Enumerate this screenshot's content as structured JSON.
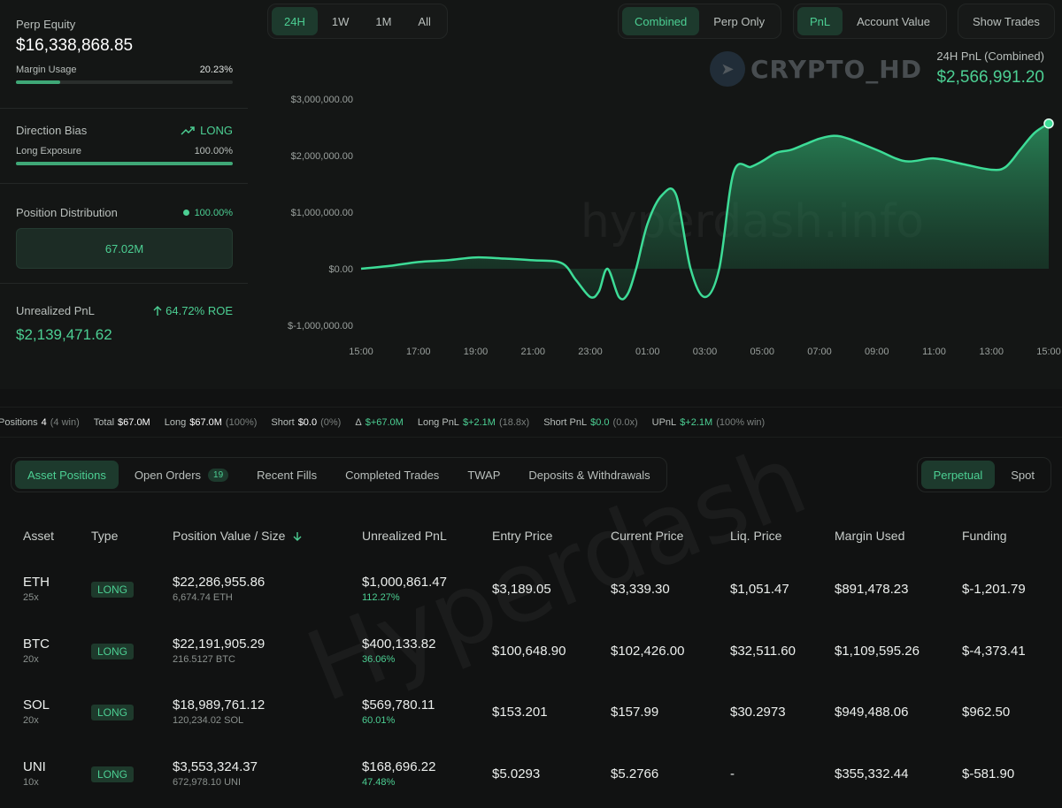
{
  "left": {
    "equity_label": "Perp Equity",
    "equity_value": "$16,338,868.85",
    "margin_label": "Margin Usage",
    "margin_value": "20.23%",
    "margin_fraction": 0.2023,
    "bias_label": "Direction Bias",
    "bias_value": "LONG",
    "long_exposure_label": "Long Exposure",
    "long_exposure_value": "100.00%",
    "long_exposure_fraction": 1.0,
    "distribution_label": "Position Distribution",
    "distribution_value": "100.00%",
    "distribution_box": "67.02M",
    "upnl_label": "Unrealized PnL",
    "upnl_roe": "64.72% ROE",
    "upnl_value": "$2,139,471.62"
  },
  "timeframes": [
    "24H",
    "1W",
    "1M",
    "All"
  ],
  "active_timeframe": "24H",
  "mode_tabs": [
    "Combined",
    "Perp Only"
  ],
  "active_mode": "Combined",
  "metric_tabs": [
    "PnL",
    "Account Value"
  ],
  "active_metric": "PnL",
  "show_trades_label": "Show Trades",
  "pnl_header": {
    "label": "24H PnL (Combined)",
    "value": "$2,566,991.20"
  },
  "watermarks": {
    "brand": "CRYPTO_HD",
    "site": "hyperdash.info",
    "table": "Hyperdash"
  },
  "chart_data": {
    "type": "area",
    "y_tick_labels": [
      "$3,000,000.00",
      "$2,000,000.00",
      "$1,000,000.00",
      "$0.00",
      "$-1,000,000.00"
    ],
    "x_tick_labels": [
      "15:00",
      "17:00",
      "19:00",
      "21:00",
      "23:00",
      "01:00",
      "03:00",
      "05:00",
      "07:00",
      "09:00",
      "11:00",
      "13:00",
      "15:00"
    ],
    "ylim": [
      -1000000,
      3000000
    ],
    "grid": false,
    "x_hours": [
      0,
      1,
      2,
      3,
      4,
      5,
      6,
      7,
      7.5,
      8,
      8.3,
      8.6,
      9,
      9.3,
      9.6,
      10,
      10.5,
      11,
      11.5,
      12,
      12.5,
      13,
      13.6,
      14,
      14.5,
      15,
      15.5,
      16,
      16.5,
      17,
      18,
      19,
      20,
      21,
      22,
      22.5,
      23,
      23.5,
      24
    ],
    "values": [
      0,
      50000,
      120000,
      150000,
      200000,
      180000,
      150000,
      100000,
      -200000,
      -500000,
      -400000,
      0,
      -500000,
      -450000,
      0,
      800000,
      1300000,
      1300000,
      0,
      -500000,
      0,
      1700000,
      1800000,
      1900000,
      2050000,
      2100000,
      2200000,
      2300000,
      2350000,
      2300000,
      2100000,
      1900000,
      1950000,
      1850000,
      1750000,
      1800000,
      2100000,
      2400000,
      2566991
    ]
  },
  "stats": {
    "positions_label": "Positions",
    "positions_value": "4",
    "positions_note": "(4 win)",
    "total_label": "Total",
    "total_value": "$67.0M",
    "long_label": "Long",
    "long_value": "$67.0M",
    "long_note": "(100%)",
    "short_label": "Short",
    "short_value": "$0.0",
    "short_note": "(0%)",
    "delta_label": "Δ",
    "delta_value": "$+67.0M",
    "longpnl_label": "Long PnL",
    "longpnl_value": "$+2.1M",
    "longpnl_note": "(18.8x)",
    "shortpnl_label": "Short PnL",
    "shortpnl_value": "$0.0",
    "shortpnl_note": "(0.0x)",
    "upnl_label": "UPnL",
    "upnl_value": "$+2.1M",
    "upnl_note": "(100% win)"
  },
  "tabs": [
    "Asset Positions",
    "Open Orders",
    "Recent Fills",
    "Completed Trades",
    "TWAP",
    "Deposits & Withdrawals"
  ],
  "open_orders_count": "19",
  "active_tab": "Asset Positions",
  "market_tabs": [
    "Perpetual",
    "Spot"
  ],
  "active_market": "Perpetual",
  "table": {
    "headers": [
      "Asset",
      "Type",
      "Position Value / Size",
      "Unrealized PnL",
      "Entry Price",
      "Current Price",
      "Liq. Price",
      "Margin Used",
      "Funding"
    ],
    "sort_icon": "arrow-down-icon",
    "rows": [
      {
        "asset": "ETH",
        "leverage": "25x",
        "type": "LONG",
        "value": "$22,286,955.86",
        "size": "6,674.74 ETH",
        "pnl": "$1,000,861.47",
        "pnl_pct": "112.27%",
        "entry": "$3,189.05",
        "current": "$3,339.30",
        "liq": "$1,051.47",
        "margin": "$891,478.23",
        "funding": "$-1,201.79",
        "funding_positive": false
      },
      {
        "asset": "BTC",
        "leverage": "20x",
        "type": "LONG",
        "value": "$22,191,905.29",
        "size": "216.5127 BTC",
        "pnl": "$400,133.82",
        "pnl_pct": "36.06%",
        "entry": "$100,648.90",
        "current": "$102,426.00",
        "liq": "$32,511.60",
        "margin": "$1,109,595.26",
        "funding": "$-4,373.41",
        "funding_positive": false
      },
      {
        "asset": "SOL",
        "leverage": "20x",
        "type": "LONG",
        "value": "$18,989,761.12",
        "size": "120,234.02 SOL",
        "pnl": "$569,780.11",
        "pnl_pct": "60.01%",
        "entry": "$153.201",
        "current": "$157.99",
        "liq": "$30.2973",
        "margin": "$949,488.06",
        "funding": "$962.50",
        "funding_positive": true
      },
      {
        "asset": "UNI",
        "leverage": "10x",
        "type": "LONG",
        "value": "$3,553,324.37",
        "size": "672,978.10 UNI",
        "pnl": "$168,696.22",
        "pnl_pct": "47.48%",
        "entry": "$5.0293",
        "current": "$5.2766",
        "liq": "-",
        "margin": "$355,332.44",
        "funding": "$-581.90",
        "funding_positive": false
      }
    ]
  }
}
